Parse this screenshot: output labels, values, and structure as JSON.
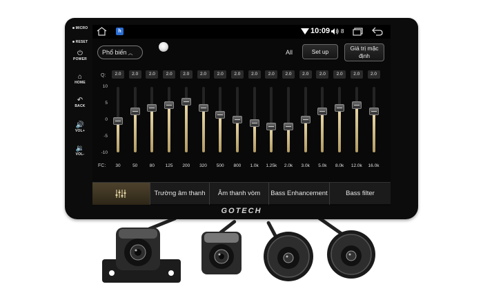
{
  "bezel": {
    "side_buttons": [
      {
        "label": "MICRO"
      },
      {
        "label": "RESET"
      },
      {
        "label": "POWER",
        "icon": "power-icon"
      },
      {
        "label": "HOME",
        "icon": "home-icon"
      },
      {
        "label": "BACK",
        "icon": "back-icon"
      },
      {
        "label": "VOL+",
        "icon": "volume-up-icon"
      },
      {
        "label": "VOL-",
        "icon": "volume-down-icon"
      }
    ],
    "brand": "GOTECH"
  },
  "statusbar": {
    "time": "10:09",
    "volume": "8",
    "app_icon_letter": "h"
  },
  "toolbar": {
    "preset_label": "Phổ biến",
    "all_label": "All",
    "setup_label": "Set up",
    "default_label_line1": "Giá trị mặc",
    "default_label_line2": "định"
  },
  "equalizer": {
    "q_label": "Q:",
    "fc_label": "FC:",
    "db_scale": [
      "10",
      "5",
      "0",
      "-5",
      "-10"
    ],
    "bands": [
      {
        "q": "2.0",
        "freq": "30",
        "gain": -0.5
      },
      {
        "q": "2.0",
        "freq": "50",
        "gain": 2.5
      },
      {
        "q": "2.0",
        "freq": "80",
        "gain": 3.5
      },
      {
        "q": "2.0",
        "freq": "125",
        "gain": 4.5
      },
      {
        "q": "2.0",
        "freq": "200",
        "gain": 5.5
      },
      {
        "q": "2.0",
        "freq": "320",
        "gain": 3.5
      },
      {
        "q": "2.0",
        "freq": "500",
        "gain": 1.5
      },
      {
        "q": "2.0",
        "freq": "800",
        "gain": 0
      },
      {
        "q": "2.0",
        "freq": "1.0k",
        "gain": -1
      },
      {
        "q": "2.0",
        "freq": "1.25k",
        "gain": -2
      },
      {
        "q": "2.0",
        "freq": "2.0k",
        "gain": -2
      },
      {
        "q": "2.0",
        "freq": "3.0k",
        "gain": 0
      },
      {
        "q": "2.0",
        "freq": "5.0k",
        "gain": 2.5
      },
      {
        "q": "2.0",
        "freq": "8.0k",
        "gain": 3.5
      },
      {
        "q": "2.0",
        "freq": "12.0k",
        "gain": 4.5
      },
      {
        "q": "2.0",
        "freq": "16.0k",
        "gain": 2.5
      }
    ]
  },
  "tabs": [
    {
      "label": "",
      "icon": "equalizer-icon",
      "active": true
    },
    {
      "label": "Trường âm thanh",
      "active": false
    },
    {
      "label": "Âm thanh vòm",
      "active": false
    },
    {
      "label": "Bass Enhancement",
      "active": false
    },
    {
      "label": "Bass filter",
      "active": false
    }
  ],
  "colors": {
    "accent": "#c8b27a",
    "tab_active": "#3b3322"
  }
}
